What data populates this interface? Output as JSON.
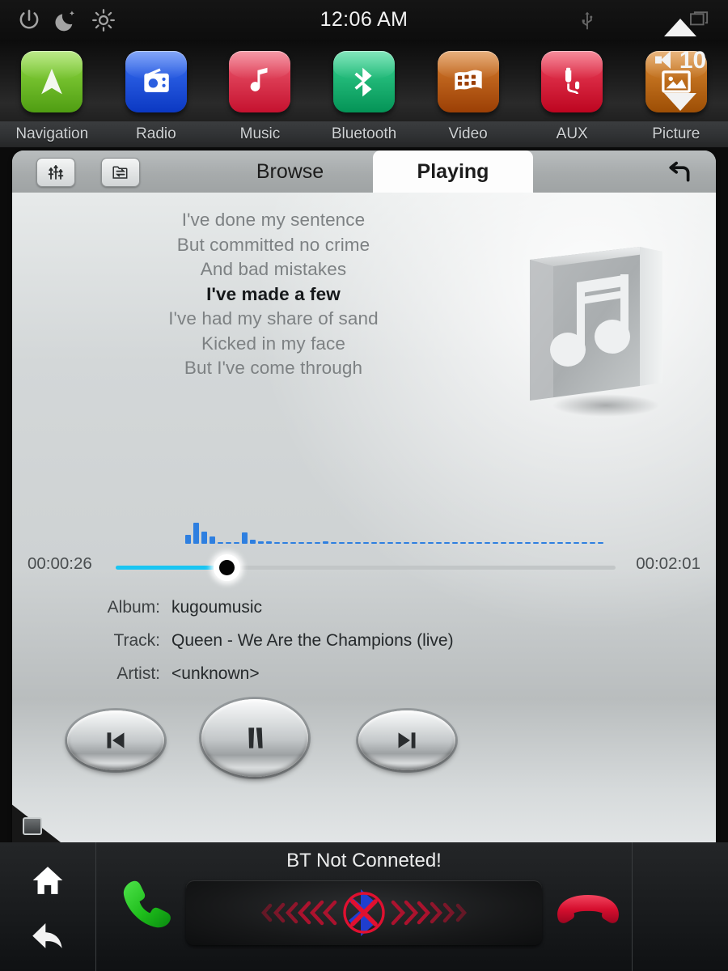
{
  "statusbar": {
    "clock": "12:06 AM",
    "icons": [
      "power-icon",
      "night-mode-icon",
      "brightness-icon",
      "usb-icon",
      "recent-apps-icon"
    ]
  },
  "dock": {
    "apps": [
      {
        "label": "Navigation",
        "icon": "navigation-arrow-icon",
        "color": "#76c62c"
      },
      {
        "label": "Radio",
        "icon": "radio-icon",
        "color": "#1b55e8"
      },
      {
        "label": "Music",
        "icon": "music-note-icon",
        "color": "#e03a55"
      },
      {
        "label": "Bluetooth",
        "icon": "bluetooth-icon",
        "color": "#16b870"
      },
      {
        "label": "Video",
        "icon": "film-strip-icon",
        "color": "#c2540e"
      },
      {
        "label": "AUX",
        "icon": "aux-cable-icon",
        "color": "#e01b34"
      },
      {
        "label": "Picture",
        "icon": "picture-icon",
        "color": "#c2620e"
      }
    ]
  },
  "player": {
    "toolbar": {
      "equalizer_icon": "equalizer-icon",
      "folder_icon": "folder-repeat-icon",
      "back_icon": "back-arrow-icon",
      "tabs": [
        {
          "label": "Browse",
          "active": false
        },
        {
          "label": "Playing",
          "active": true
        }
      ]
    },
    "lyrics": [
      {
        "text": "I've done my sentence",
        "active": false
      },
      {
        "text": "But committed no crime",
        "active": false
      },
      {
        "text": "And bad mistakes",
        "active": false
      },
      {
        "text": "I've made a few",
        "active": true
      },
      {
        "text": "I've had my share of sand",
        "active": false
      },
      {
        "text": "Kicked in my face",
        "active": false
      },
      {
        "text": "But I've come through",
        "active": false
      }
    ],
    "album_art": "music-note-placeholder-icon",
    "progress": {
      "current_time": "00:00:26",
      "total_time": "00:02:01",
      "percent": 22.5,
      "fill_color": "#19c5f2"
    },
    "visualizer": {
      "color": "#2e7fe0",
      "bars": [
        11,
        26,
        15,
        9,
        2,
        2,
        2,
        14,
        5,
        3,
        3,
        2,
        2,
        2,
        2,
        2,
        2,
        3,
        2,
        2,
        2,
        2,
        2,
        2,
        2,
        2,
        2,
        2,
        2,
        2,
        2,
        2,
        2,
        2,
        2,
        2,
        2,
        2,
        2,
        2,
        2,
        2,
        2,
        2,
        2,
        2,
        2,
        2,
        2,
        2,
        2,
        2
      ]
    },
    "metadata": [
      {
        "key": "Album:",
        "value": "kugoumusic"
      },
      {
        "key": "Track:",
        "value": "Queen - We Are the Champions (live)"
      },
      {
        "key": "Artist:",
        "value": "<unknown>"
      }
    ],
    "transport": {
      "previous": "previous-track-icon",
      "play_pause": "pause-icon",
      "next": "next-track-icon"
    }
  },
  "bottombar": {
    "home_icon": "home-icon",
    "back_icon": "back-arrow-icon",
    "call_icon": "call-phone-icon",
    "hangup_icon": "hangup-phone-icon",
    "bt_status": "BT Not Conneted!",
    "bt_panel_icon": "bluetooth-disconnected-icon",
    "volume": {
      "level": "10",
      "up_icon": "volume-up-icon",
      "down_icon": "volume-down-icon",
      "speaker_icon": "speaker-icon"
    }
  }
}
